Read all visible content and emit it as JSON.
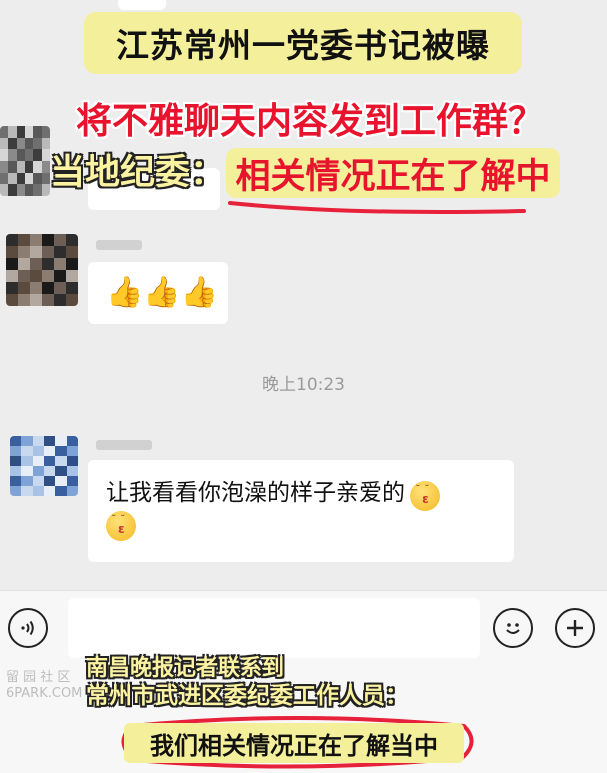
{
  "headline": "江苏常州一党委书记被曝",
  "subheadline": "将不雅聊天内容发到工作群？",
  "jiwei": {
    "label": "当地纪委：",
    "statement": "相关情况正在了解中"
  },
  "chat": {
    "thumbs_emoji": "👍👍👍",
    "timestamp": "晚上10:23",
    "message_text": "让我看看你泡澡的样子亲爱的"
  },
  "captions": {
    "line1": "南昌晚报记者联系到",
    "line2": "常州市武进区委纪委工作人员：",
    "line3": "我们相关情况正在了解当中"
  },
  "watermark": {
    "line1": "留 园 社 区",
    "line2": "6PARK.COM"
  },
  "colors": {
    "banner_yellow": "#f4ef9a",
    "red_text": "#e8132d",
    "chat_bg": "#ededed",
    "bubble_white": "#ffffff"
  },
  "icons": {
    "voice": "voice-icon",
    "emoji": "emoji-icon",
    "plus": "plus-icon"
  }
}
